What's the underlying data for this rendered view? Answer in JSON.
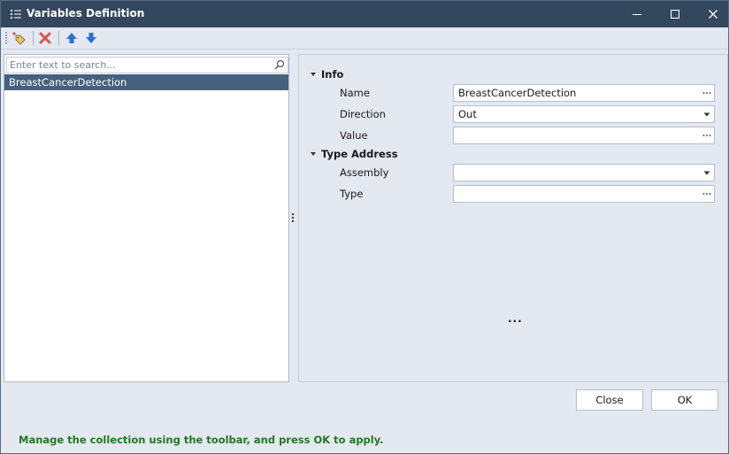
{
  "window": {
    "title": "Variables Definition",
    "minimize_icon": "minimize-icon",
    "maximize_icon": "maximize-icon",
    "close_icon": "close-icon"
  },
  "toolbar": {
    "buttons": [
      {
        "icon": "add-tag-icon"
      },
      {
        "icon": "delete-icon",
        "color": "#d9534f"
      },
      {
        "icon": "arrow-up-icon",
        "color": "#2f6fd0"
      },
      {
        "icon": "arrow-down-icon",
        "color": "#2f6fd0"
      }
    ]
  },
  "search": {
    "placeholder": "Enter text to search...",
    "value": ""
  },
  "variables": [
    {
      "label": "BreastCancerDetection",
      "selected": true
    }
  ],
  "properties": {
    "info": {
      "label": "Info",
      "name": {
        "label": "Name",
        "value": "BreastCancerDetection"
      },
      "direction": {
        "label": "Direction",
        "value": "Out"
      },
      "value": {
        "label": "Value",
        "value": ""
      }
    },
    "type_address": {
      "label": "Type Address",
      "assembly": {
        "label": "Assembly",
        "value": ""
      },
      "type": {
        "label": "Type",
        "value": ""
      }
    }
  },
  "description": "...",
  "buttons": {
    "close": "Close",
    "ok": "OK"
  },
  "status_text": "Manage the collection using the toolbar, and press OK to apply.",
  "colors": {
    "title_bar": "#33475e",
    "selection": "#47607e",
    "status": "#1e7a1e",
    "background": "#e4e8f0"
  }
}
